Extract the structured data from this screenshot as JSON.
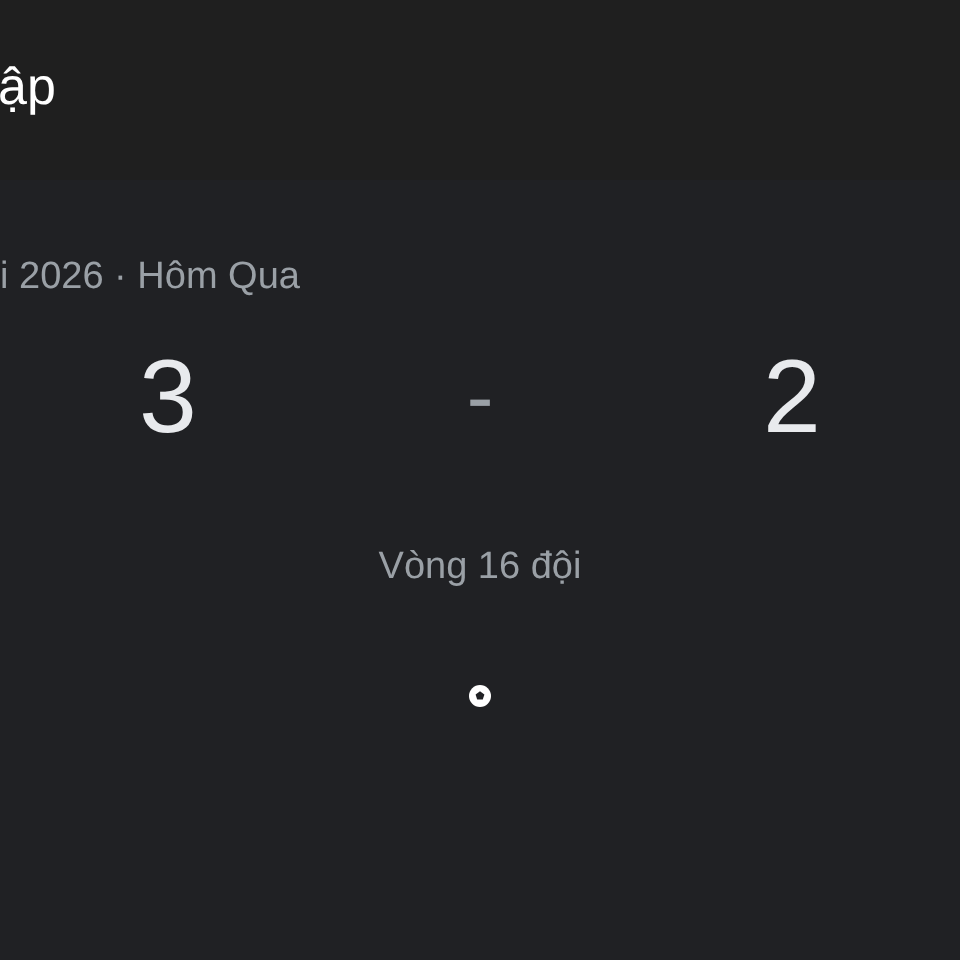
{
  "header": {
    "title": "ập"
  },
  "match": {
    "info": "i 2026 · Hôm Qua",
    "home_score": "3",
    "separator": "-",
    "away_score": "2",
    "stage": "Vòng 16 đội"
  }
}
